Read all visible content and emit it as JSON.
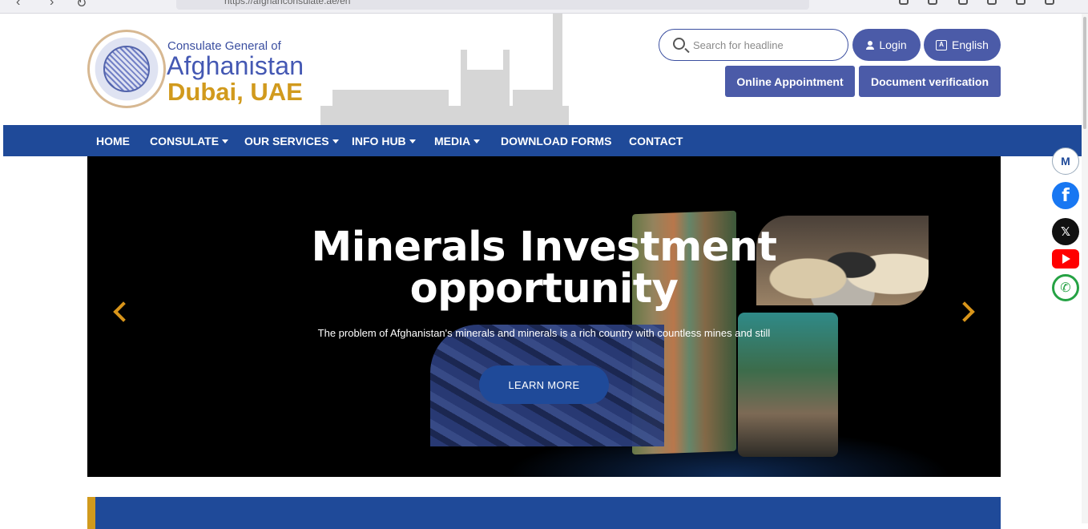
{
  "browser": {
    "url": "https://afghanconsulate.ae/en"
  },
  "header": {
    "brand_line1": "Consulate General of",
    "brand_line2": "Afghanistan",
    "brand_line3": "Dubai, UAE",
    "search_placeholder": "Search for headline",
    "login_label": "Login",
    "language_label": "English",
    "appointment_label": "Online Appointment",
    "verification_label": "Document verification"
  },
  "nav": {
    "items": [
      {
        "label": "HOME",
        "dropdown": false
      },
      {
        "label": "CONSULATE",
        "dropdown": true
      },
      {
        "label": "OUR SERVICES",
        "dropdown": true
      },
      {
        "label": "INFO HUB",
        "dropdown": true
      },
      {
        "label": "MEDIA",
        "dropdown": true
      },
      {
        "label": "DOWNLOAD FORMS",
        "dropdown": false
      },
      {
        "label": "CONTACT",
        "dropdown": false
      }
    ]
  },
  "hero": {
    "title_line1": "Minerals Investment",
    "title_line2": "opportunity",
    "description": "The problem of Afghanistan's minerals and minerals is a rich country with countless mines and still",
    "button_label": "LEARN MORE"
  },
  "social": {
    "m_label": "M",
    "facebook_label": "f",
    "x_label": "𝕏",
    "whatsapp_label": "✆"
  },
  "colors": {
    "primary_blue": "#1f4a99",
    "button_blue": "#4b5ba8",
    "gold": "#d19a1d"
  }
}
